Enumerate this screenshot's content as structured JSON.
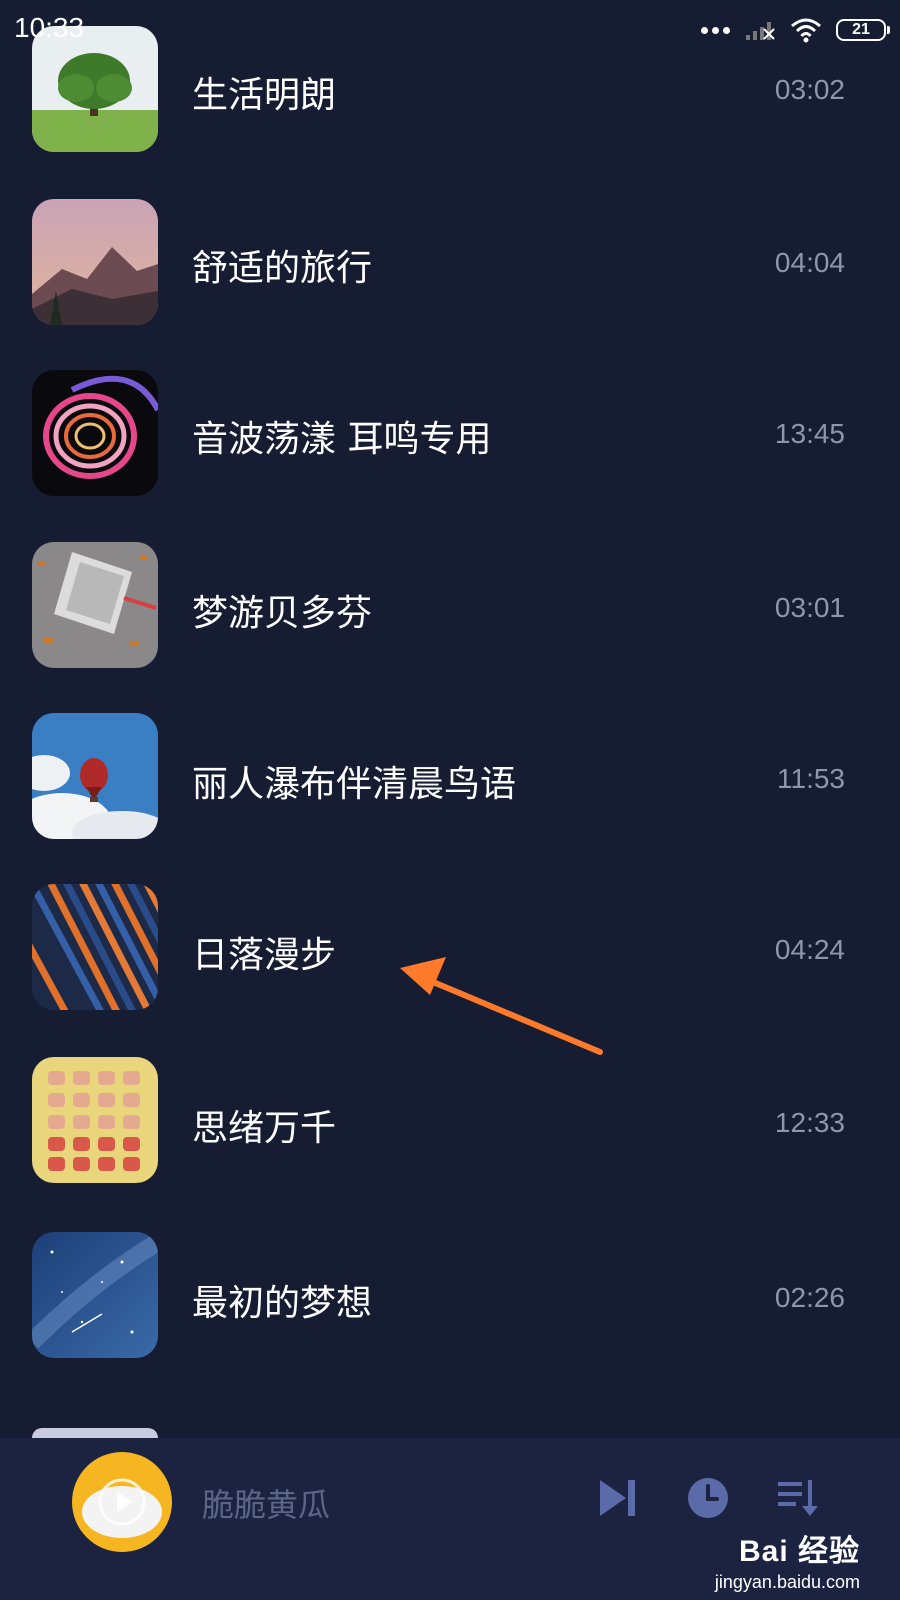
{
  "status_bar": {
    "time": "10:33",
    "battery": "21",
    "icons": [
      "more-dots-icon",
      "signal-icon",
      "wifi-icon",
      "battery-icon"
    ]
  },
  "tracks": [
    {
      "title": "生活明朗",
      "duration": "03:02",
      "cover": "tree-meadow"
    },
    {
      "title": "舒适的旅行",
      "duration": "04:04",
      "cover": "mountain-sunset"
    },
    {
      "title": "音波荡漾 耳鸣专用",
      "duration": "13:45",
      "cover": "rainbow-spiral"
    },
    {
      "title": "梦游贝多芬",
      "duration": "03:01",
      "cover": "skyscraper"
    },
    {
      "title": "丽人瀑布伴清晨鸟语",
      "duration": "11:53",
      "cover": "hot-air-balloon"
    },
    {
      "title": "日落漫步",
      "duration": "04:24",
      "cover": "stripes"
    },
    {
      "title": "思绪万千",
      "duration": "12:33",
      "cover": "toast-grid"
    },
    {
      "title": "最初的梦想",
      "duration": "02:26",
      "cover": "starry-sky"
    }
  ],
  "player": {
    "now_playing": "脆脆黄瓜",
    "controls": [
      "next-icon",
      "timer-icon",
      "playlist-icon"
    ]
  },
  "watermark": {
    "main": "Bai 经验",
    "sub": "jingyan.baidu.com"
  },
  "colors": {
    "background": "#161d33",
    "player_bg": "#1b2341",
    "duration_text": "#8f96a9",
    "arrow": "#ff7a2a",
    "control_icon": "#5b6aa8"
  }
}
